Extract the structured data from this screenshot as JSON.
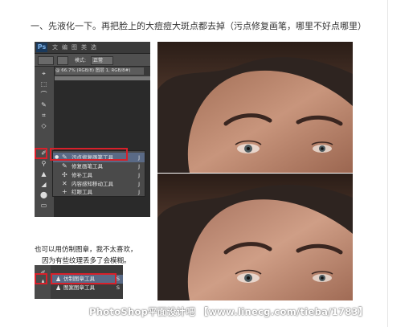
{
  "heading": "一、先液化一下。再把脸上的大痘痘大斑点都去掉（污点修复画笔，哪里不好点哪里）",
  "ps": {
    "logo": "Ps",
    "menu": [
      "文",
      "编",
      "图",
      "类",
      "选"
    ],
    "options_mode_label": "模式:",
    "options_mode_value": "正常",
    "doc_tab": "@ 66.7% (RGB/8) 图层 1, RGB/8#)",
    "tools": [
      "⌖",
      "⬚",
      "⌒",
      "✎",
      "⌗",
      "◇",
      "✐",
      "⚲",
      "▲",
      "◢",
      "⬤",
      "▭"
    ],
    "flyout": [
      {
        "label": "污点修复画笔工具",
        "key": "J",
        "icon": "bandage-icon",
        "glyph": "✎",
        "selected": true
      },
      {
        "label": "修复画笔工具",
        "key": "J",
        "icon": "healing-brush-icon",
        "glyph": "✎",
        "selected": false
      },
      {
        "label": "修补工具",
        "key": "J",
        "icon": "patch-icon",
        "glyph": "✣",
        "selected": false
      },
      {
        "label": "内容感知移动工具",
        "key": "J",
        "icon": "content-aware-move-icon",
        "glyph": "✕",
        "selected": false
      },
      {
        "label": "红眼工具",
        "key": "J",
        "icon": "red-eye-icon",
        "glyph": "+",
        "selected": false
      }
    ]
  },
  "note_line1": "也可以用仿制图章，我不太喜欢，",
  "note_line2": "因为有些纹理丢多了会模糊。",
  "ps2": {
    "rows": [
      {
        "label": "仿制图章工具",
        "key": "S",
        "icon": "clone-stamp-icon",
        "glyph": "♟",
        "selected": true
      },
      {
        "label": "图案图章工具",
        "key": "S",
        "icon": "pattern-stamp-icon",
        "glyph": "♟",
        "selected": false
      }
    ]
  },
  "watermark": "PhotoShop平面设计吧 【www.linecg.com/tieba/1783】",
  "colors": {
    "highlight": "#d8202a",
    "ps_bg": "#3c3c3c"
  }
}
